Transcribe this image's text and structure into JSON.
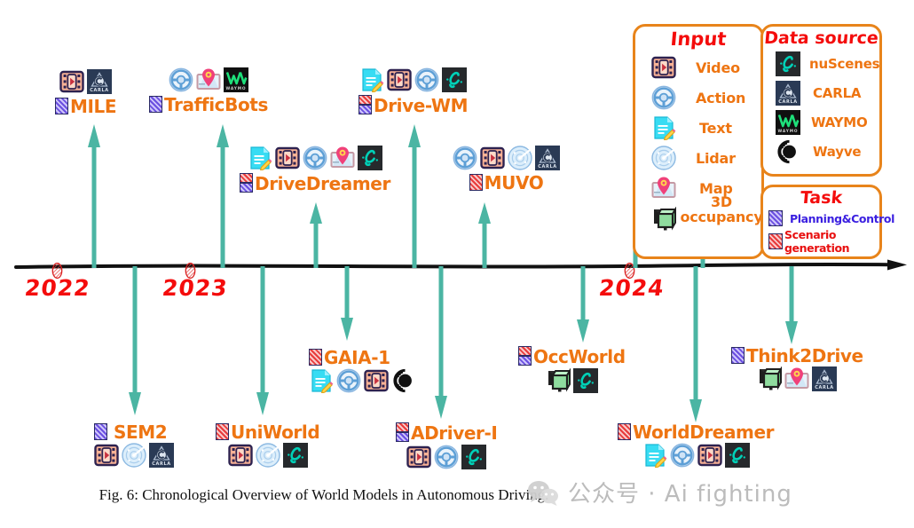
{
  "figure": {
    "caption": "Fig. 6: Chronological Overview of World Models in Autonomous Driving.",
    "accent_orange": "#ee7512",
    "accent_red": "#f40c0c",
    "arrow_teal": "#4bb5a3",
    "panel_border": "#e8841b"
  },
  "axis": {
    "years": [
      "2022",
      "2023",
      "2024"
    ]
  },
  "legend": {
    "input": {
      "title": "Input",
      "items": [
        {
          "icon": "video-icon",
          "label": "Video"
        },
        {
          "icon": "steering-wheel-icon",
          "label": "Action"
        },
        {
          "icon": "text-document-icon",
          "label": "Text"
        },
        {
          "icon": "lidar-radar-icon",
          "label": "Lidar"
        },
        {
          "icon": "map-pin-icon",
          "label": "Map"
        },
        {
          "icon": "occupancy-cube-icon",
          "label": "3D occupancy"
        }
      ]
    },
    "data_source": {
      "title": "Data source",
      "items": [
        {
          "icon": "nuscenes-logo-icon",
          "label": "nuScenes"
        },
        {
          "icon": "carla-logo-icon",
          "label": "CARLA"
        },
        {
          "icon": "waymo-logo-icon",
          "label": "WAYMO"
        },
        {
          "icon": "wayve-logo-icon",
          "label": "Wayve"
        }
      ]
    },
    "task": {
      "title": "Task",
      "items": [
        {
          "badge": "planning-control-badge",
          "label": "Planning&Control"
        },
        {
          "badge": "scenario-generation-badge",
          "label": "Scenario generation"
        }
      ]
    }
  },
  "models": [
    {
      "name": "MILE",
      "tasks": [
        "pc"
      ],
      "inputs": [
        "video",
        "carla"
      ]
    },
    {
      "name": "SEM2",
      "tasks": [
        "pc"
      ],
      "inputs": [
        "video",
        "lidar",
        "carla"
      ]
    },
    {
      "name": "TrafficBots",
      "tasks": [
        "pc"
      ],
      "inputs": [
        "action",
        "map",
        "waymo"
      ]
    },
    {
      "name": "UniWorld",
      "tasks": [
        "sg"
      ],
      "inputs": [
        "video",
        "lidar",
        "nuscenes"
      ]
    },
    {
      "name": "DriveDreamer",
      "tasks": [
        "sg",
        "pc"
      ],
      "inputs": [
        "text",
        "video",
        "action",
        "map",
        "nuscenes"
      ]
    },
    {
      "name": "GAIA-1",
      "tasks": [
        "sg"
      ],
      "inputs": [
        "text",
        "action",
        "video",
        "wayve"
      ]
    },
    {
      "name": "Drive-WM",
      "tasks": [
        "sg",
        "pc"
      ],
      "inputs": [
        "text",
        "video",
        "action",
        "nuscenes"
      ]
    },
    {
      "name": "ADriver-I",
      "tasks": [
        "sg",
        "pc"
      ],
      "inputs": [
        "video",
        "action",
        "nuscenes"
      ]
    },
    {
      "name": "MUVO",
      "tasks": [
        "sg"
      ],
      "inputs": [
        "action",
        "video",
        "lidar",
        "carla"
      ]
    },
    {
      "name": "OccWorld",
      "tasks": [
        "sg",
        "pc"
      ],
      "inputs": [
        "occupancy",
        "nuscenes"
      ]
    },
    {
      "name": "WorldDreamer",
      "tasks": [
        "sg"
      ],
      "inputs": [
        "text",
        "action",
        "video",
        "nuscenes"
      ]
    },
    {
      "name": "Think2Drive",
      "tasks": [
        "pc"
      ],
      "inputs": [
        "occupancy",
        "map",
        "carla"
      ]
    }
  ],
  "watermark": {
    "text": "公众号 · Ai fighting"
  }
}
